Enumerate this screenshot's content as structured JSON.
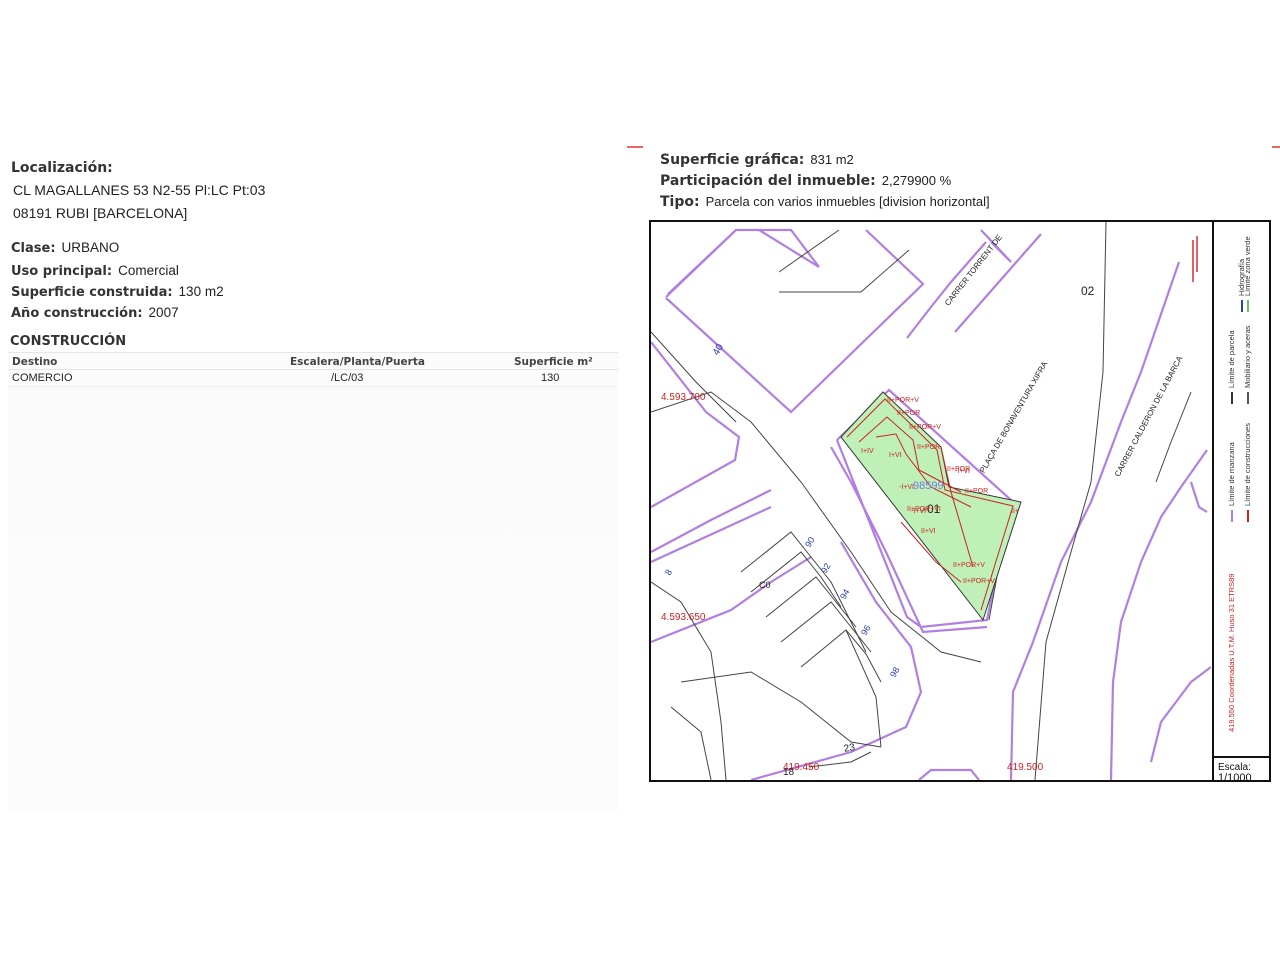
{
  "left": {
    "localizacion_label": "Localización:",
    "address_line1": "CL MAGALLANES 53 N2-55 Pl:LC Pt:03",
    "address_line2": "08191 RUBI [BARCELONA]",
    "clase_label": "Clase:",
    "clase_value": "URBANO",
    "uso_label": "Uso principal:",
    "uso_value": "Comercial",
    "superficie_label": "Superficie construida:",
    "superficie_value": "130 m2",
    "ano_label": "Año construcción:",
    "ano_value": "2007",
    "construccion_title": "CONSTRUCCIÓN",
    "table": {
      "headers": [
        "Destino",
        "Escalera/Planta/Puerta",
        "Superficie m²"
      ],
      "rows": [
        [
          "COMERCIO",
          "/LC/03",
          "130"
        ]
      ]
    }
  },
  "right": {
    "sup_grafica_label": "Superficie gráfica:",
    "sup_grafica_value": "831 m2",
    "participacion_label": "Participación del inmueble:",
    "participacion_value": "2,279900 %",
    "tipo_label": "Tipo:",
    "tipo_value": "Parcela con varios inmuebles [division horizontal]"
  },
  "map": {
    "streets": [
      "CARRER TORRENT DE",
      "PLAÇA DE BONAVENTURA XIFRA",
      "CARRER CALDERON DE LA BARCA"
    ],
    "coords": {
      "y1": "4.593.700",
      "y2": "4.593.650",
      "x1": "419.450",
      "x2": "419.500",
      "utm": "419.550 Coordenadas U.T.M. Huso 31 ETRS89"
    },
    "parcel_numbers": [
      "02",
      "01",
      "40",
      "8",
      "C0",
      "90",
      "92",
      "94",
      "96",
      "98",
      "23",
      "18"
    ],
    "parcel_ref": "98599",
    "floor_labels": [
      "II+POR+V",
      "II+POR",
      "II+POR+V",
      "I+IV",
      "II+POR",
      "II+POR",
      "-I+VI",
      "I+VI",
      "-I+VI",
      "II+POR+VI",
      "II+POR",
      "II+VI",
      "-I+VI",
      "II+POR+V",
      "II+POR+V",
      "II+"
    ],
    "legend": [
      "Límite de manzana",
      "Límite de parcela",
      "Hidrografía",
      "Límite de construcciones",
      "Mobiliario y aceras",
      "Límite zona verde"
    ],
    "scale_label": "Escala:",
    "scale_value": "1/1000",
    "colors": {
      "block": "#b07fe0",
      "parcel": "#333333",
      "construction": "#cc2222",
      "green": "#bff0b8",
      "label_red": "#cc2222",
      "label_blue": "#2a3fb0"
    }
  }
}
